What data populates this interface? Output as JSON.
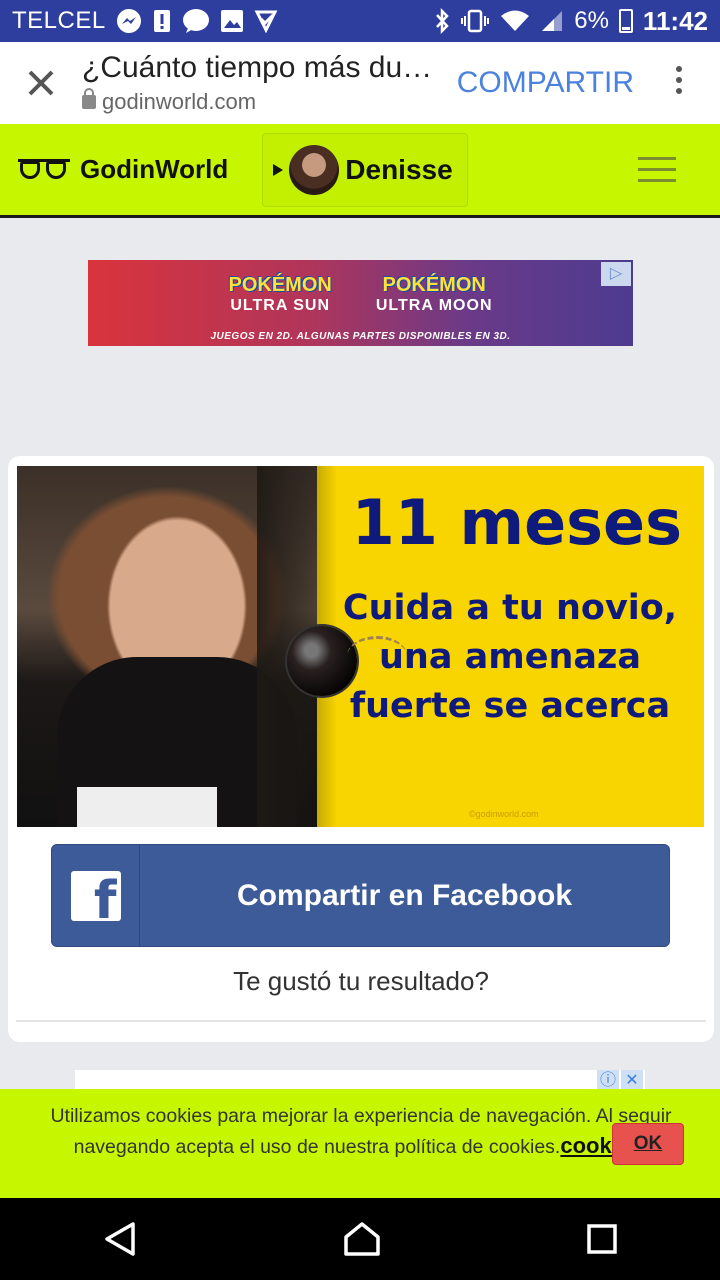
{
  "status_bar": {
    "carrier": "TELCEL",
    "battery": "6%",
    "time": "11:42"
  },
  "browser": {
    "page_title": "¿Cuánto tiempo más du…",
    "url": "godinworld.com",
    "share_label": "COMPARTIR"
  },
  "site_header": {
    "logo_text": "GodinWorld",
    "user_name": "Denisse"
  },
  "ad_top": {
    "game1_brand": "POKÉMON",
    "game1_name": "ULTRA SUN",
    "game2_brand": "POKÉMON",
    "game2_name": "ULTRA MOON",
    "tagline": "JUEGOS EN 2D. ALGUNAS PARTES DISPONIBLES EN 3D."
  },
  "result": {
    "months": "11 meses",
    "message": "Cuida a tu novio, una amenaza fuerte se acerca",
    "watermark": "©godinworld.com",
    "facebook_button": "Compartir en Facebook",
    "question": "Te gustó tu resultado?"
  },
  "cookie_banner": {
    "text": "Utilizamos cookies para mejorar la experiencia de navegación. Al seguir navegando acepta el uso de nuestra política de cookies.",
    "link": "cookies.",
    "ok_label": "OK"
  },
  "colors": {
    "status_bar": "#2d3e9e",
    "header_accent": "#c7f700",
    "facebook_blue": "#3d5a99",
    "result_yellow": "#f8d400",
    "result_text": "#0e1a7c",
    "ok_button": "#e8524e"
  }
}
